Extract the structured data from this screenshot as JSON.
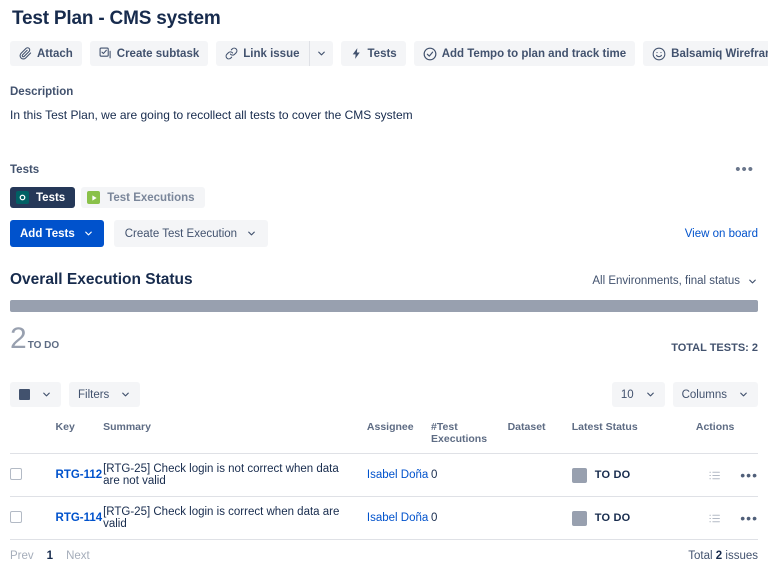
{
  "header": {
    "title": "Test Plan - CMS system"
  },
  "toolbar": {
    "buttons": [
      {
        "label": "Attach",
        "icon": "paperclip-icon"
      },
      {
        "label": "Create subtask",
        "icon": "subtask-icon"
      },
      {
        "label": "Link issue",
        "icon": "link-icon",
        "has_caret": true
      },
      {
        "label": "Tests",
        "icon": "lightning-icon"
      },
      {
        "label": "Add Tempo to plan and track time",
        "icon": "check-circle-icon"
      },
      {
        "label": "Balsamiq Wireframes",
        "icon": "smiley-icon"
      }
    ]
  },
  "description": {
    "label": "Description",
    "text": "In this Test Plan, we are going to recollect all tests to cover the CMS system"
  },
  "tests_panel": {
    "label": "Tests",
    "more_menu": "•••",
    "tabs": [
      {
        "label": "Tests",
        "icon": "tests-square-icon",
        "active": true
      },
      {
        "label": "Test Executions",
        "icon": "executions-play-icon",
        "active": false
      }
    ],
    "add_tests_label": "Add Tests",
    "create_execution_label": "Create Test Execution",
    "view_on_board_label": "View on board"
  },
  "execution_status": {
    "title": "Overall Execution Status",
    "filter_label": "All Environments, final status",
    "stat_number": "2",
    "stat_label": "TO DO",
    "total_tests_label": "TOTAL TESTS: 2",
    "bar_color": "#98a0af"
  },
  "filters": {
    "color_select_label": "",
    "filters_label": "Filters",
    "page_size": "10",
    "columns_label": "Columns"
  },
  "table": {
    "columns": [
      "",
      "Key",
      "Summary",
      "Assignee",
      "#Test Executions",
      "Dataset",
      "Latest Status",
      "Actions"
    ],
    "rows": [
      {
        "key": "RTG-112",
        "summary": "[RTG-25] Check login is not correct when data are not valid",
        "assignee": "Isabel Doña",
        "executions": "0",
        "dataset": "",
        "status": "TO DO",
        "status_color": "#98a0af"
      },
      {
        "key": "RTG-114",
        "summary": "[RTG-25] Check login is correct when data are valid",
        "assignee": "Isabel Doña",
        "executions": "0",
        "dataset": "",
        "status": "TO DO",
        "status_color": "#98a0af"
      }
    ]
  },
  "pagination": {
    "prev_label": "Prev",
    "current_page": "1",
    "next_label": "Next",
    "total_prefix": "Total",
    "total_count": "2",
    "total_suffix": "issues"
  }
}
